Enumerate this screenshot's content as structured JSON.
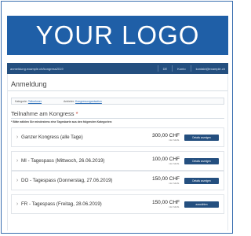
{
  "logo": {
    "text": "YOUR LOGO"
  },
  "topbar": {
    "left_text": "anmeldung.example.ch/kongress2019",
    "lang": "DE",
    "account": "Konto",
    "contact": "kontakt@example.ch"
  },
  "page": {
    "title": "Anmeldung"
  },
  "info": {
    "label1": "Kategorie:",
    "link1": "Teilnehmer",
    "label2": "Anbieter:",
    "link2": "Kongressorganisation"
  },
  "section": {
    "title": "Teilnahme am Kongress",
    "required_mark": "*",
    "note": "* Bitte wählen Sie mindestens eine Tageskarte aus den folgenden Kategorien:"
  },
  "rows": [
    {
      "label": "Ganzer Kongress (alle Tage)",
      "price": "300,00 CHF",
      "sub": "inkl. MwSt.",
      "button": "Details anzeigen"
    },
    {
      "label": "MI - Tagespass (Mittwoch, 26.06.2019)",
      "price": "100,00 CHF",
      "sub": "inkl. MwSt.",
      "button": "Details anzeigen"
    },
    {
      "label": "DO - Tagespass (Donnerstag, 27.06.2019)",
      "price": "150,00 CHF",
      "sub": "inkl. MwSt.",
      "button": "Details anzeigen"
    },
    {
      "label": "FR - Tagespass (Freitag, 28.06.2019)",
      "price": "150,00 CHF",
      "sub": "inkl. MwSt.",
      "button": "auswählen"
    }
  ],
  "colors": {
    "brand": "#1f5fa7",
    "nav": "#244f7f",
    "link": "#2a6db8",
    "required": "#c0392b"
  }
}
